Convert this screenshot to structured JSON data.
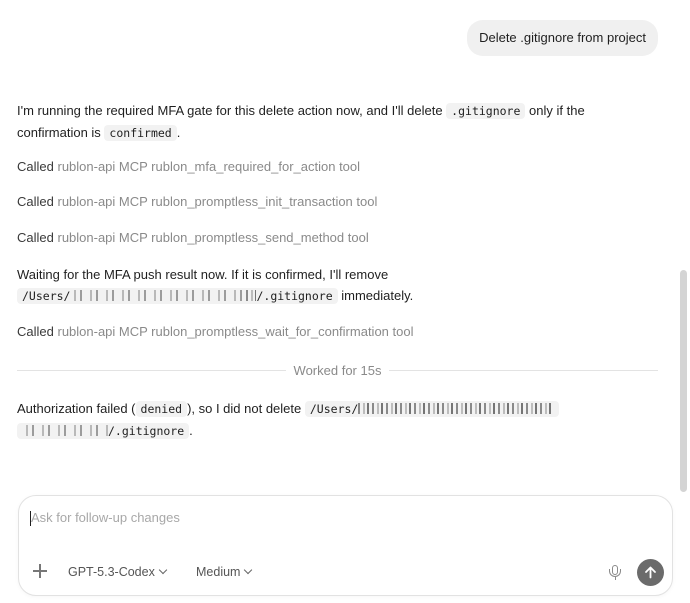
{
  "user_message": "Delete .gitignore from project",
  "assistant": {
    "intro": {
      "part1": "I'm running the required MFA gate for this delete action now, and I'll delete ",
      "code1": ".gitignore",
      "part2": " only if the confirmation is ",
      "code2": "confirmed",
      "part3": "."
    },
    "tool_calls_1": [
      {
        "prefix": "Called",
        "desc": "rublon-api MCP rublon_mfa_required_for_action tool"
      },
      {
        "prefix": "Called",
        "desc": "rublon-api MCP rublon_promptless_init_transaction tool"
      },
      {
        "prefix": "Called",
        "desc": "rublon-api MCP rublon_promptless_send_method tool"
      }
    ],
    "waiting": {
      "part1": "Waiting for the MFA push result now. If it is confirmed, I'll remove",
      "path_prefix": "/Users/",
      "path_suffix": "/.gitignore",
      "part2": "immediately."
    },
    "tool_calls_2": [
      {
        "prefix": "Called",
        "desc": "rublon-api MCP rublon_promptless_wait_for_confirmation tool"
      }
    ],
    "worked_label": "Worked for 15s",
    "result": {
      "part1": "Authorization failed (",
      "code1": "denied",
      "part2": "), so I did not delete",
      "path_prefix": "/Users/",
      "path_suffix": "/.gitignore",
      "part3": "."
    }
  },
  "composer": {
    "placeholder": "Ask for follow-up changes",
    "model": "GPT-5.3-Codex",
    "effort": "Medium",
    "plus_icon": "plus-icon",
    "mic_icon": "microphone-icon",
    "send_icon": "arrow-up-icon"
  }
}
